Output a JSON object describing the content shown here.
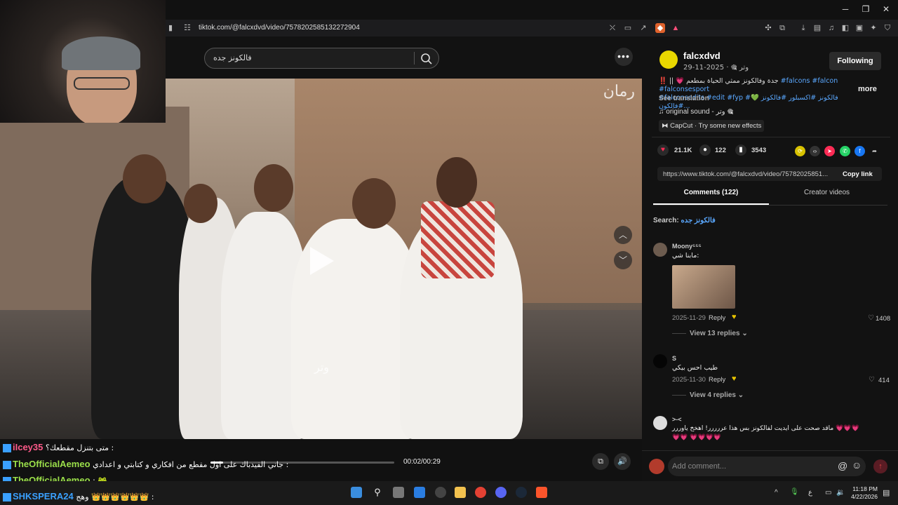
{
  "browser": {
    "url": "tiktok.com/@falcxdvd/video/7578202585132272904"
  },
  "tiktok": {
    "search_query": "فالكونز جده",
    "video": {
      "watermark_top": "رمان",
      "watermark_mid": "وتر",
      "time": "00:02/00:29",
      "progress": 0.07
    },
    "author": {
      "username": "falcxdvd",
      "subline": "وتر 🎕 · 2025-11-29",
      "follow_label": "Following",
      "description_text": "‼️ || 💗 جدة وفالكونز ممثي الحياة بمطعم",
      "tags_line1": "#falcons #falcon #falconsesport",
      "tags_line2": "#falconsedits #edit #fyp #فالكونز #اكسبلور #فالكونز 💚 #فالكون...",
      "more_label": "more",
      "see_translation": "See translation",
      "sound": "original sound - وتر 🎕",
      "capcut": "CapCut · Try some new effects"
    },
    "stats": {
      "likes": "21.1K",
      "comments": "122",
      "saves": "3543"
    },
    "link": {
      "text": "https://www.tiktok.com/@falcxdvd/video/75782025851...",
      "copy_label": "Copy link"
    },
    "tabs": {
      "comments": "Comments (122)",
      "creator": "Creator videos"
    },
    "search_line": {
      "prefix": "Search:",
      "keyword": "فالكونز جده"
    },
    "comments": [
      {
        "name": "Moony⁵⁵⁵",
        "text": "مابنا شي:",
        "date": "2025-11-29",
        "reply": "Reply",
        "likes": "1408",
        "view_replies": "View 13 replies"
      },
      {
        "name": "S",
        "text": "طيب احس بيكي",
        "date": "2025-11-30",
        "reply": "Reply",
        "likes": "414",
        "view_replies": "View 4 replies"
      },
      {
        "name": ">-<",
        "text": "ماقد صحت على ايديت لفالكونز بس هذا عررررر! اهخخ ياوررر 💗💗💗💗💗 💗💗💗💗"
      }
    ],
    "comment_placeholder": "Add comment..."
  },
  "chat": [
    {
      "user": "iIcey35",
      "color": "#ff5a8a",
      "msg": "متى بتنزل مقطعك؟ :"
    },
    {
      "user": "TheOfficialAemeo",
      "color": "#9be04a",
      "msg": "جاني الفيدباك على اول مقطع من افكاري و كتابتي و اعدادي :"
    },
    {
      "user": "TheOfficialAemeo",
      "color": "#9be04a",
      "msg": ": 🐸"
    },
    {
      "user": "SHKSPERA24",
      "color": "#3aa0ff",
      "msg": "وهج 👑👑👑👑👑👑 :"
    }
  ],
  "taskbar": {
    "time": "11:18 PM",
    "date": "4/22/2026"
  },
  "colors": {
    "accent": "#fe2c55",
    "link": "#5aa8ff"
  }
}
